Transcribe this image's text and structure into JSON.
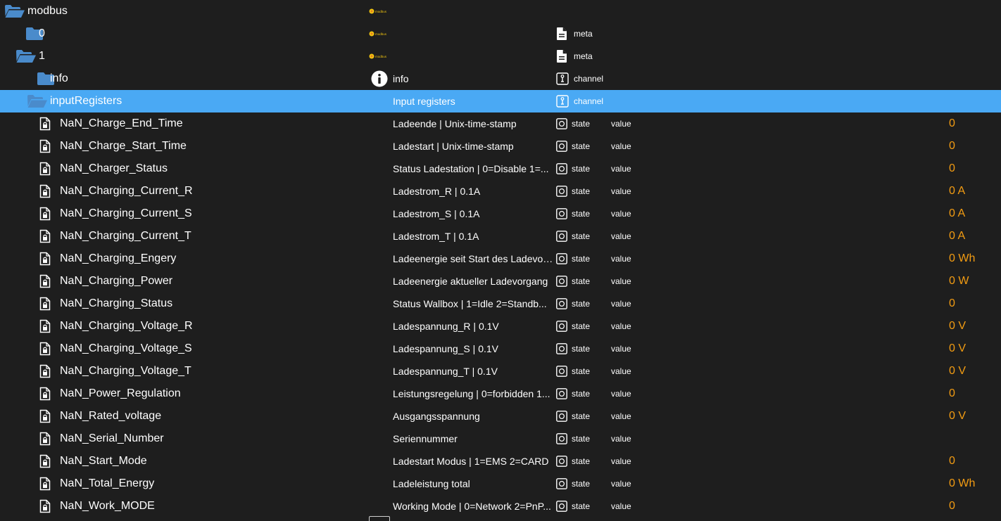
{
  "colors": {
    "background": "#1e1e1e",
    "selected_row": "#4aa9f4",
    "folder": "#4a8bcb",
    "value": "#f39c12",
    "text": "#ffffff"
  },
  "tree": {
    "folders": [
      {
        "name": "modbus",
        "type": "",
        "open": true,
        "level": 0,
        "icon": "adapter-logo-icon"
      },
      {
        "name": "0",
        "type": "meta",
        "open": false,
        "level": 1,
        "icon": "adapter-logo-icon"
      },
      {
        "name": "1",
        "type": "meta",
        "open": true,
        "level": 1,
        "icon": "adapter-logo-icon"
      },
      {
        "name": "info",
        "desc": "info",
        "type": "channel",
        "open": false,
        "level": 2,
        "icon": "info-icon"
      },
      {
        "name": "inputRegisters",
        "desc": "Input registers",
        "type": "channel",
        "open": true,
        "level": 2,
        "selected": true
      }
    ],
    "states": [
      {
        "name": "NaN_Charge_End_Time",
        "desc": "Ladeende | Unix-time-stamp",
        "type": "state",
        "role": "value",
        "value": "0"
      },
      {
        "name": "NaN_Charge_Start_Time",
        "desc": "Ladestart | Unix-time-stamp",
        "type": "state",
        "role": "value",
        "value": "0"
      },
      {
        "name": "NaN_Charger_Status",
        "desc": "Status Ladestation | 0=Disable 1=...",
        "type": "state",
        "role": "value",
        "value": "0"
      },
      {
        "name": "NaN_Charging_Current_R",
        "desc": "Ladestrom_R | 0.1A",
        "type": "state",
        "role": "value",
        "value": "0 A"
      },
      {
        "name": "NaN_Charging_Current_S",
        "desc": "Ladestrom_S | 0.1A",
        "type": "state",
        "role": "value",
        "value": "0 A"
      },
      {
        "name": "NaN_Charging_Current_T",
        "desc": "Ladestrom_T | 0.1A",
        "type": "state",
        "role": "value",
        "value": "0 A"
      },
      {
        "name": "NaN_Charging_Engery",
        "desc": "Ladeenergie seit Start des Ladevor...",
        "type": "state",
        "role": "value",
        "value": "0 Wh"
      },
      {
        "name": "NaN_Charging_Power",
        "desc": "Ladeenergie aktueller Ladevorgang",
        "type": "state",
        "role": "value",
        "value": "0 W"
      },
      {
        "name": "NaN_Charging_Status",
        "desc": "Status Wallbox | 1=Idle 2=Standb...",
        "type": "state",
        "role": "value",
        "value": "0"
      },
      {
        "name": "NaN_Charging_Voltage_R",
        "desc": "Ladespannung_R | 0.1V",
        "type": "state",
        "role": "value",
        "value": "0 V"
      },
      {
        "name": "NaN_Charging_Voltage_S",
        "desc": "Ladespannung_S | 0.1V",
        "type": "state",
        "role": "value",
        "value": "0 V"
      },
      {
        "name": "NaN_Charging_Voltage_T",
        "desc": "Ladespannung_T | 0.1V",
        "type": "state",
        "role": "value",
        "value": "0 V"
      },
      {
        "name": "NaN_Power_Regulation",
        "desc": "Leistungsregelung | 0=forbidden 1...",
        "type": "state",
        "role": "value",
        "value": "0"
      },
      {
        "name": "NaN_Rated_voltage",
        "desc": "Ausgangsspannung",
        "type": "state",
        "role": "value",
        "value": "0 V"
      },
      {
        "name": "NaN_Serial_Number",
        "desc": "Seriennummer",
        "type": "state",
        "role": "value",
        "value": ""
      },
      {
        "name": "NaN_Start_Mode",
        "desc": "Ladestart Modus | 1=EMS 2=CARD",
        "type": "state",
        "role": "value",
        "value": "0"
      },
      {
        "name": "NaN_Total_Energy",
        "desc": "Ladeleistung total",
        "type": "state",
        "role": "value",
        "value": "0 Wh"
      },
      {
        "name": "NaN_Work_MODE",
        "desc": "Working Mode | 0=Network 2=PnP...",
        "type": "state",
        "role": "value",
        "value": "0"
      }
    ]
  }
}
